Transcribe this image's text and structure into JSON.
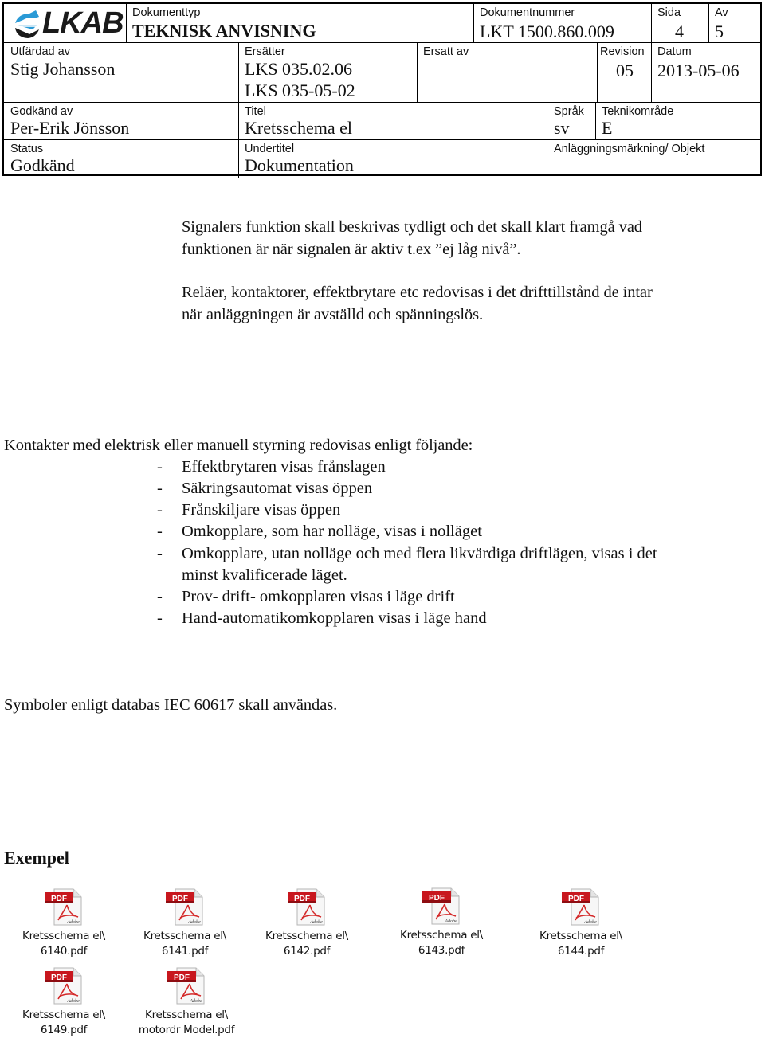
{
  "header": {
    "logo_text": "LKAB",
    "dokumenttyp": {
      "label": "Dokumenttyp",
      "value": "TEKNISK ANVISNING"
    },
    "dokumentnummer": {
      "label": "Dokumentnummer",
      "value": "LKT 1500.860.009"
    },
    "sida": {
      "label": "Sida",
      "value": "4"
    },
    "av": {
      "label": "Av",
      "value": "5"
    },
    "utfardad_av": {
      "label": "Utfärdad av",
      "value": "Stig Johansson"
    },
    "ersatter": {
      "label": "Ersätter",
      "values": [
        "LKS 035.02.06",
        "LKS 035-05-02"
      ]
    },
    "ersatt_av": {
      "label": "Ersatt av",
      "value": ""
    },
    "revision": {
      "label": "Revision",
      "value": "05"
    },
    "datum": {
      "label": "Datum",
      "value": "2013-05-06"
    },
    "godkand_av": {
      "label": "Godkänd av",
      "value": "Per-Erik Jönsson"
    },
    "titel": {
      "label": "Titel",
      "value": "Kretsschema el"
    },
    "sprak": {
      "label": "Språk",
      "value": "sv"
    },
    "teknikomrade": {
      "label": "Teknikområde",
      "value": "E"
    },
    "status": {
      "label": "Status",
      "value": "Godkänd"
    },
    "undertitel": {
      "label": "Undertitel",
      "value": "Dokumentation"
    },
    "anlaggningsmarkning": {
      "label": "Anläggningsmärkning/ Objekt",
      "value": ""
    }
  },
  "body": {
    "para1": [
      "Signalers funktion skall beskrivas tydligt och det skall klart framgå vad",
      "funktionen är när signalen är aktiv t.ex ”ej låg nivå”."
    ],
    "para2": [
      "Reläer, kontaktorer, effektbrytare etc redovisas i det drifttillstånd de intar",
      "när anläggningen är avställd och spänningslös."
    ],
    "list_intro": "Kontakter med elektrisk eller manuell styrning redovisas enligt följande:",
    "list_bullet": "-",
    "list_items": [
      "Effektbrytaren visas frånslagen",
      "Säkringsautomat visas öppen",
      "Frånskiljare visas öppen",
      "Omkopplare, som har nolläge, visas i nolläget",
      "Omkopplare, utan nolläge och med flera likvärdiga driftlägen, visas i det",
      "minst kvalificerade läget.",
      "Prov- drift- omkopplaren visas i läge drift",
      "Hand-automatikomkopplaren visas i läge hand"
    ],
    "symbols_note": "Symboler enligt databas IEC 60617 skall användas.",
    "example_heading": "Exempel"
  },
  "attachments": [
    {
      "line1": "Kretsschema el\\",
      "line2": "6140.pdf",
      "icon": "pdf-file-icon"
    },
    {
      "line1": "Kretsschema el\\",
      "line2": "6141.pdf",
      "icon": "pdf-file-icon"
    },
    {
      "line1": "Kretsschema el\\",
      "line2": "6142.pdf",
      "icon": "pdf-file-icon"
    },
    {
      "line1": "Kretsschema el\\",
      "line2": "6143.pdf",
      "icon": "pdf-file-icon"
    },
    {
      "line1": "Kretsschema el\\",
      "line2": "6144.pdf",
      "icon": "pdf-file-icon"
    },
    {
      "line1": "Kretsschema el\\",
      "line2": "6149.pdf",
      "icon": "pdf-file-icon"
    },
    {
      "line1": "Kretsschema el\\",
      "line2": "motordr Model.pdf",
      "icon": "pdf-file-icon"
    }
  ],
  "colors": {
    "logo_blue": "#2a9ad6",
    "logo_dark": "#1a1a1a",
    "pdf_red": "#c8171e"
  }
}
